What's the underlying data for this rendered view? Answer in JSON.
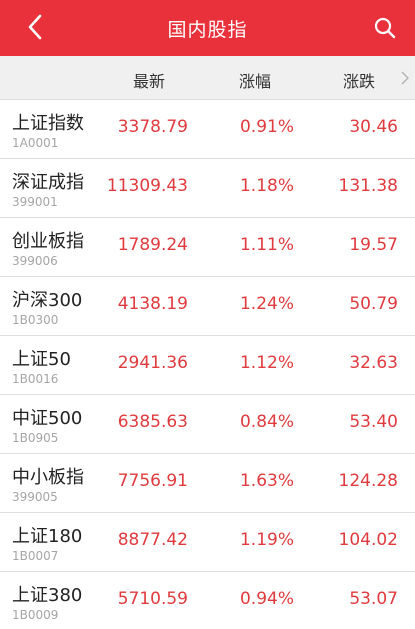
{
  "header": {
    "title": "国内股指",
    "back_icon": "back-chevron-icon",
    "search_icon": "search-icon",
    "color": "#e8313a"
  },
  "columns": {
    "latest": "最新",
    "pct": "涨幅",
    "change": "涨跌",
    "more_icon": "chevron-right-icon"
  },
  "rows": [
    {
      "name": "上证指数",
      "code": "1A0001",
      "latest": "3378.79",
      "pct": "0.91%",
      "change": "30.46"
    },
    {
      "name": "深证成指",
      "code": "399001",
      "latest": "11309.43",
      "pct": "1.18%",
      "change": "131.38"
    },
    {
      "name": "创业板指",
      "code": "399006",
      "latest": "1789.24",
      "pct": "1.11%",
      "change": "19.57"
    },
    {
      "name": "沪深300",
      "code": "1B0300",
      "latest": "4138.19",
      "pct": "1.24%",
      "change": "50.79"
    },
    {
      "name": "上证50",
      "code": "1B0016",
      "latest": "2941.36",
      "pct": "1.12%",
      "change": "32.63"
    },
    {
      "name": "中证500",
      "code": "1B0905",
      "latest": "6385.63",
      "pct": "0.84%",
      "change": "53.40"
    },
    {
      "name": "中小板指",
      "code": "399005",
      "latest": "7756.91",
      "pct": "1.63%",
      "change": "124.28"
    },
    {
      "name": "上证180",
      "code": "1B0007",
      "latest": "8877.42",
      "pct": "1.19%",
      "change": "104.02"
    },
    {
      "name": "上证380",
      "code": "1B0009",
      "latest": "5710.59",
      "pct": "0.94%",
      "change": "53.07"
    }
  ],
  "colors": {
    "up": "#e03a3e"
  }
}
